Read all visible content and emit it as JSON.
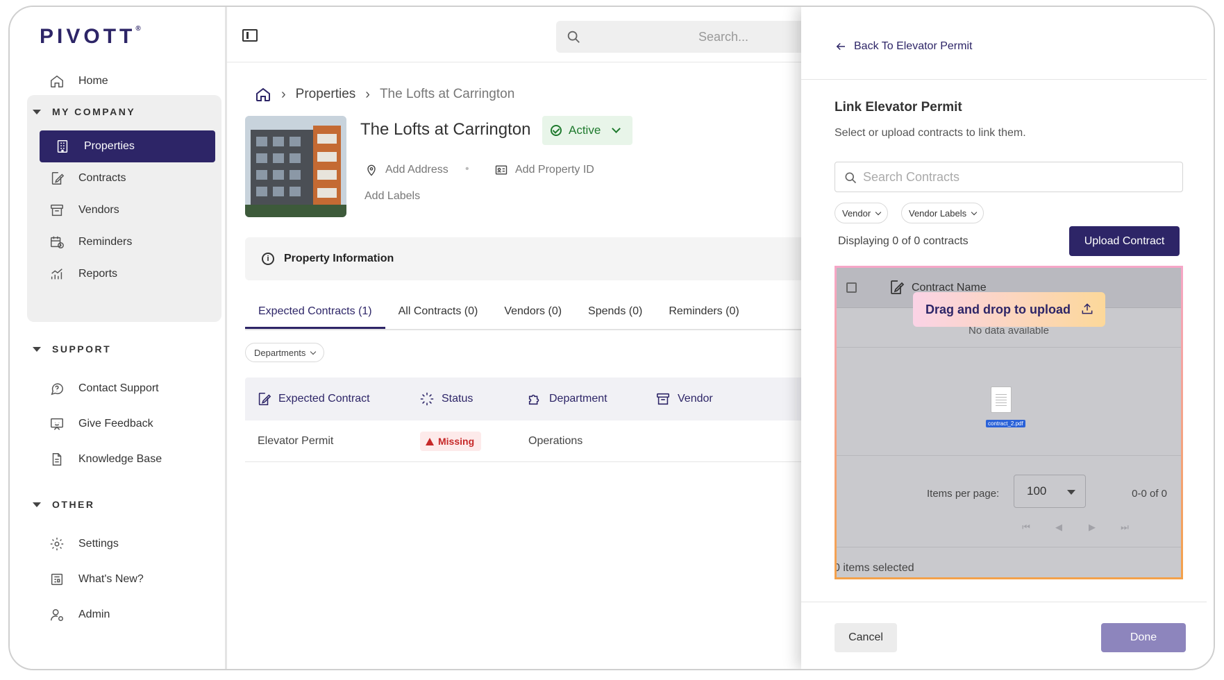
{
  "app": {
    "logo": "PIVOTT",
    "logo_mark": "®"
  },
  "sidebar": {
    "top_items": [
      {
        "label": "Home",
        "icon": "home-icon"
      }
    ],
    "sections": [
      {
        "title": "MY COMPANY",
        "items": [
          {
            "label": "Properties",
            "icon": "building-icon",
            "active": true
          },
          {
            "label": "Contracts",
            "icon": "contract-icon"
          },
          {
            "label": "Vendors",
            "icon": "store-icon"
          },
          {
            "label": "Reminders",
            "icon": "calendar-clock-icon"
          },
          {
            "label": "Reports",
            "icon": "chart-icon"
          }
        ]
      },
      {
        "title": "SUPPORT",
        "items": [
          {
            "label": "Contact Support",
            "icon": "chat-help-icon"
          },
          {
            "label": "Give Feedback",
            "icon": "feedback-icon"
          },
          {
            "label": "Knowledge Base",
            "icon": "document-icon"
          }
        ]
      },
      {
        "title": "OTHER",
        "items": [
          {
            "label": "Settings",
            "icon": "gear-icon"
          },
          {
            "label": "What's New?",
            "icon": "news-icon"
          },
          {
            "label": "Admin",
            "icon": "admin-icon"
          }
        ]
      }
    ]
  },
  "topbar": {
    "search_placeholder": "Search..."
  },
  "breadcrumb": {
    "level1": "Properties",
    "current": "The Lofts at Carrington"
  },
  "property": {
    "title": "The Lofts at Carrington",
    "status": "Active",
    "add_address": "Add Address",
    "add_property_id": "Add Property ID",
    "add_labels": "Add Labels",
    "info_title": "Property Information"
  },
  "tabs": [
    {
      "label": "Expected Contracts (1)",
      "active": true
    },
    {
      "label": "All Contracts (0)"
    },
    {
      "label": "Vendors (0)"
    },
    {
      "label": "Spends (0)"
    },
    {
      "label": "Reminders (0)"
    }
  ],
  "filters": {
    "departments": "Departments"
  },
  "table": {
    "headers": [
      "Expected Contract",
      "Status",
      "Department",
      "Vendor"
    ],
    "rows": [
      {
        "contract": "Elevator Permit",
        "status": "Missing",
        "department": "Operations"
      }
    ]
  },
  "dialog": {
    "back_label": "Back To Elevator Permit",
    "title": "Link Elevator Permit",
    "subtitle": "Select or upload contracts to link them.",
    "search_placeholder": "Search Contracts",
    "filters": [
      "Vendor",
      "Vendor Labels"
    ],
    "count_text": "Displaying 0 of 0 contracts",
    "upload_label": "Upload Contract",
    "column": "Contract Name",
    "no_data": "No data available",
    "drag_label": "Drag and drop to upload",
    "file_name": "contract_2.pdf",
    "items_per_page_label": "Items per page:",
    "items_per_page": "100",
    "range": "0-0 of 0",
    "selected": "0 items selected",
    "cancel_label": "Cancel",
    "done_label": "Done"
  },
  "colors": {
    "brand": "#2d2567",
    "active_green": "#1f7a2e",
    "missing_red": "#c62828"
  }
}
